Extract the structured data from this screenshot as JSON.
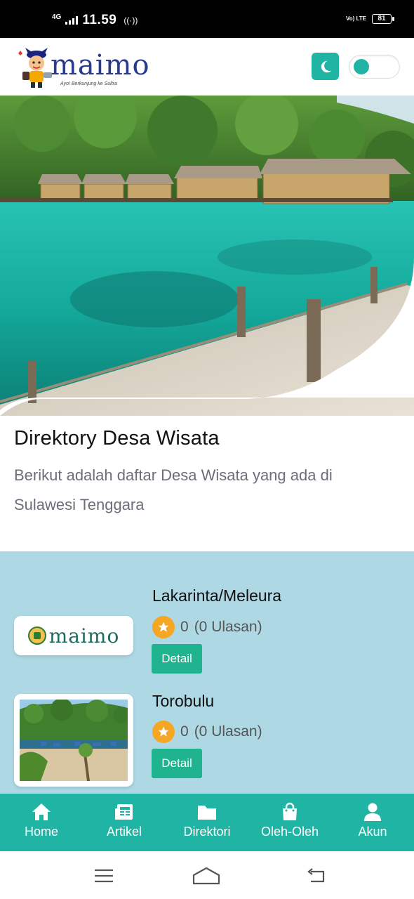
{
  "status_bar": {
    "network": "4G",
    "time": "11.59",
    "volte": "Vo) LTE",
    "battery": "81"
  },
  "header": {
    "logo_text": "maimo",
    "logo_tagline": "Ayo! Berkunjung ke Sultra",
    "dark_mode_icon": "moon-icon",
    "toggle_on": true,
    "accent_color": "#1fb4a3"
  },
  "intro": {
    "title": "Direktory Desa Wisata",
    "description": "Berikut adalah daftar Desa Wisata yang ada di Sulawesi Tenggara"
  },
  "listing": {
    "background_color": "#add8e4",
    "items": [
      {
        "name": "Lakarinta/Meleura",
        "rating": "0",
        "reviews": "(0 Ulasan)",
        "button": "Detail",
        "thumbnail": "maimo-logo",
        "thumbnail_text": "maimo"
      },
      {
        "name": "Torobulu",
        "rating": "0",
        "reviews": "(0 Ulasan)",
        "button": "Detail",
        "thumbnail": "beach-photo"
      }
    ]
  },
  "bottom_nav": {
    "items": [
      {
        "label": "Home",
        "icon": "home-icon"
      },
      {
        "label": "Artikel",
        "icon": "newspaper-icon"
      },
      {
        "label": "Direktori",
        "icon": "folder-icon"
      },
      {
        "label": "Oleh-Oleh",
        "icon": "shopping-bag-icon"
      },
      {
        "label": "Akun",
        "icon": "user-icon"
      }
    ]
  },
  "system_nav": {
    "buttons": [
      "menu-icon",
      "home-outline-icon",
      "back-icon"
    ]
  }
}
